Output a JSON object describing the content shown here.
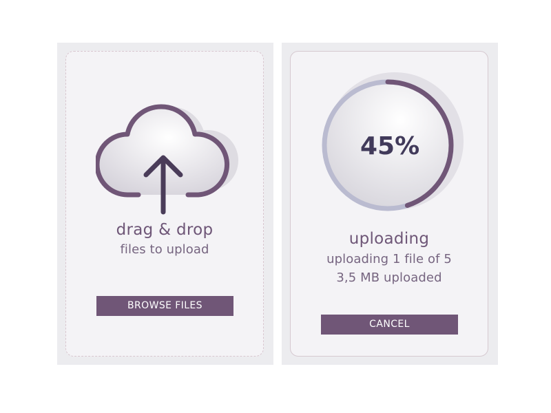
{
  "drop_card": {
    "title": "drag & drop",
    "subtitle": "files to upload",
    "browse_label": "BROWSE FILES",
    "icon": "cloud-upload-icon"
  },
  "upload_card": {
    "percent_text": "45%",
    "progress": 0.45,
    "title": "uploading",
    "status_line": "uploading 1 file of 5",
    "size_line": "3,5 MB uploaded",
    "cancel_label": "CANCEL"
  },
  "colors": {
    "accent": "#705677",
    "dark_text": "#413a5a",
    "track": "#babbd0",
    "card_bg": "#ececef",
    "panel_bg": "#f4f3f6"
  }
}
